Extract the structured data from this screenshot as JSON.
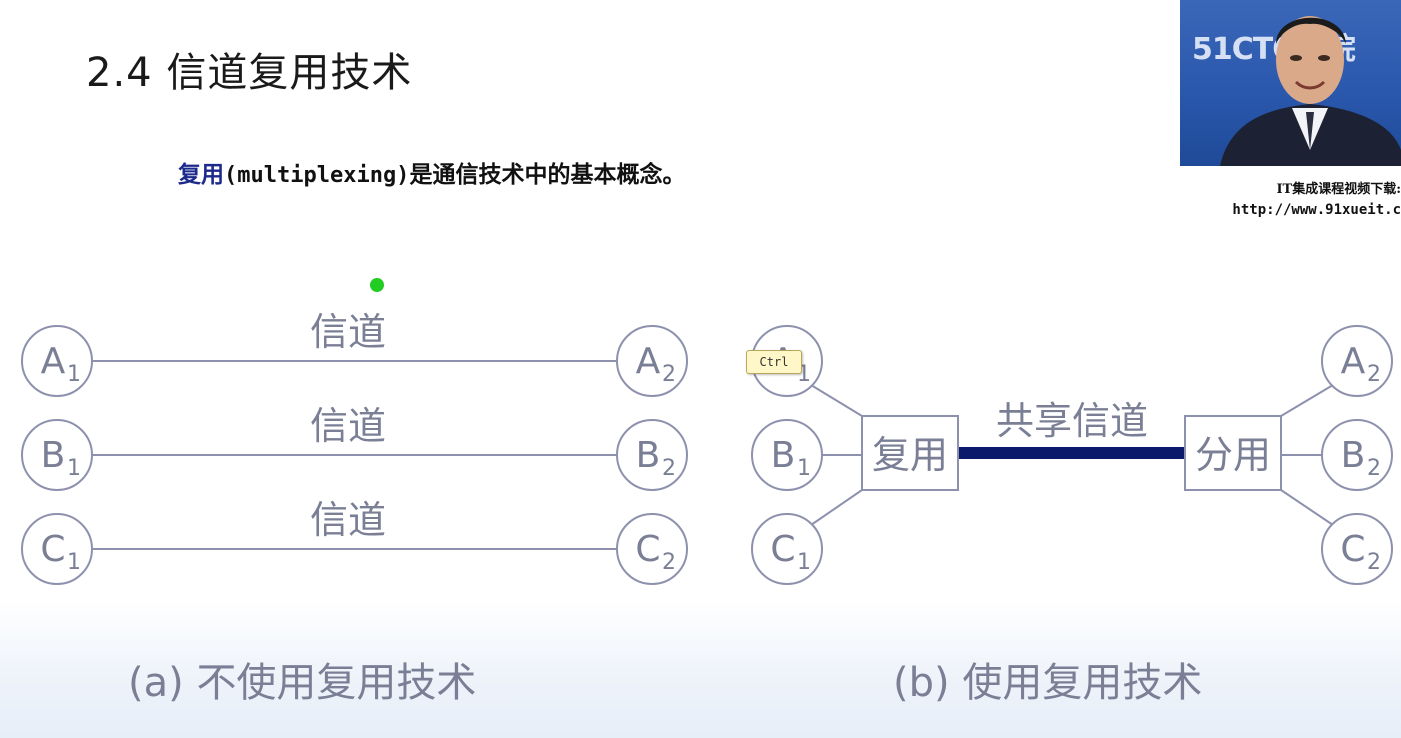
{
  "slide": {
    "title": "2.4 信道复用技术",
    "subtitle_keyword": "复用",
    "subtitle_term": "(multiplexing)",
    "subtitle_rest": "是通信技术中的基本概念。"
  },
  "webcam": {
    "logo_text": "51CTO学院",
    "caption_line1": "IT集成课程视频下载:",
    "caption_line2": "http://www.91xueit.c"
  },
  "overlay": {
    "key_hint": "Ctrl"
  },
  "diagram_a": {
    "caption": "(a) 不使用复用技术",
    "channel_label": "信道",
    "links": [
      {
        "from": "A",
        "from_sub": "1",
        "to": "A",
        "to_sub": "2"
      },
      {
        "from": "B",
        "from_sub": "1",
        "to": "B",
        "to_sub": "2"
      },
      {
        "from": "C",
        "from_sub": "1",
        "to": "C",
        "to_sub": "2"
      }
    ]
  },
  "diagram_b": {
    "caption": "(b) 使用复用技术",
    "mux_label": "复用",
    "demux_label": "分用",
    "shared_label": "共享信道",
    "left_nodes": [
      {
        "letter": "A",
        "sub": "1"
      },
      {
        "letter": "B",
        "sub": "1"
      },
      {
        "letter": "C",
        "sub": "1"
      }
    ],
    "right_nodes": [
      {
        "letter": "A",
        "sub": "2"
      },
      {
        "letter": "B",
        "sub": "2"
      },
      {
        "letter": "C",
        "sub": "2"
      }
    ]
  },
  "colors": {
    "node_stroke": "#8d91ad",
    "line": "#8d91ad",
    "label": "#7a7f95",
    "shared_channel": "#0b1a6b",
    "title": "#1a1a1a",
    "keyword": "#1c2a8c"
  }
}
